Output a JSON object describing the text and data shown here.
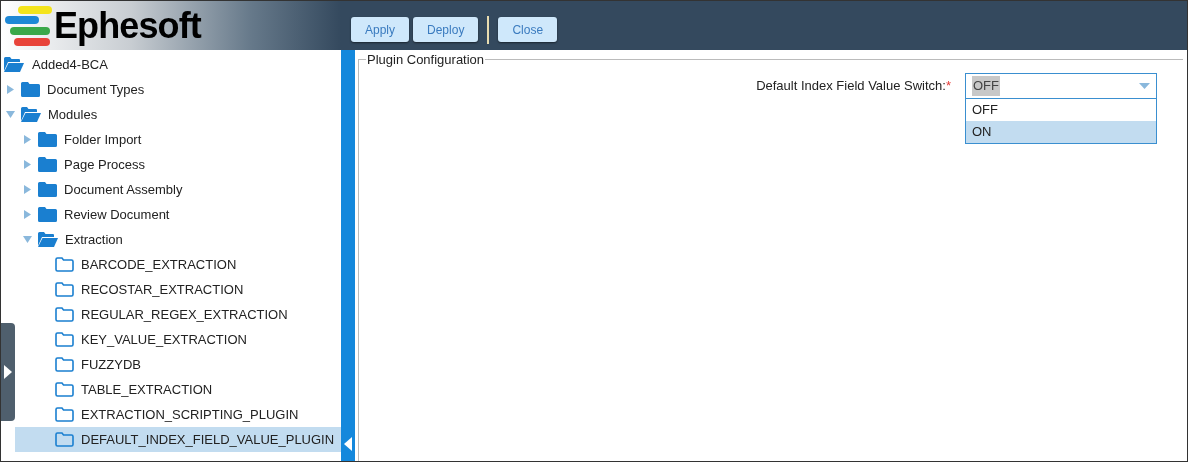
{
  "header": {
    "logo": "Ephesoft",
    "buttons": [
      {
        "label": "Apply",
        "kind": "button"
      },
      {
        "label": "Deploy",
        "kind": "button"
      },
      {
        "kind": "separator"
      },
      {
        "label": "Close",
        "kind": "button"
      }
    ]
  },
  "tree": {
    "label": "Added4-BCA",
    "kind": "root",
    "selected": false,
    "children": [
      {
        "label": "Document Types",
        "kind": "branch",
        "expanded": false,
        "selected": false
      },
      {
        "label": "Modules",
        "kind": "branch",
        "expanded": true,
        "selected": false,
        "children": [
          {
            "label": "Folder Import",
            "kind": "branch",
            "expanded": false,
            "selected": false
          },
          {
            "label": "Page Process",
            "kind": "branch",
            "expanded": false,
            "selected": false
          },
          {
            "label": "Document Assembly",
            "kind": "branch",
            "expanded": false,
            "selected": false
          },
          {
            "label": "Review Document",
            "kind": "branch",
            "expanded": false,
            "selected": false
          },
          {
            "label": "Extraction",
            "kind": "branch",
            "expanded": true,
            "selected": false,
            "children": [
              {
                "label": "BARCODE_EXTRACTION",
                "kind": "leaf",
                "selected": false
              },
              {
                "label": "RECOSTAR_EXTRACTION",
                "kind": "leaf",
                "selected": false
              },
              {
                "label": "REGULAR_REGEX_EXTRACTION",
                "kind": "leaf",
                "selected": false
              },
              {
                "label": "KEY_VALUE_EXTRACTION",
                "kind": "leaf",
                "selected": false
              },
              {
                "label": "FUZZYDB",
                "kind": "leaf",
                "selected": false
              },
              {
                "label": "TABLE_EXTRACTION",
                "kind": "leaf",
                "selected": false
              },
              {
                "label": "EXTRACTION_SCRIPTING_PLUGIN",
                "kind": "leaf",
                "selected": false
              },
              {
                "label": "DEFAULT_INDEX_FIELD_VALUE_PLUGIN",
                "kind": "leaf",
                "selected": true
              }
            ]
          }
        ]
      }
    ]
  },
  "plugin_configuration": {
    "legend": "Plugin Configuration",
    "field": {
      "label": "Default Index Field Value Switch:",
      "required_mark": "*",
      "value": "OFF",
      "expanded": true,
      "options": [
        {
          "label": "OFF",
          "highlighted": false
        },
        {
          "label": "ON",
          "highlighted": true
        }
      ]
    }
  }
}
